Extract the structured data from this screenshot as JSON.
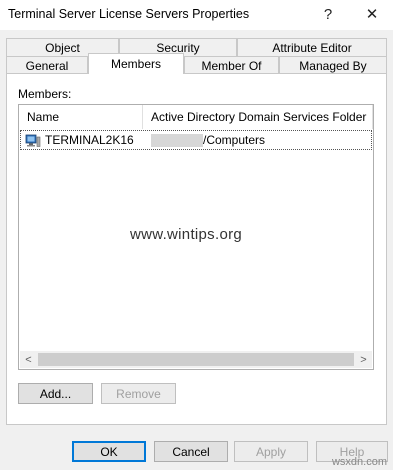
{
  "window": {
    "title": "Terminal Server License Servers Properties",
    "help_glyph": "?",
    "close_glyph": "✕"
  },
  "tabs": {
    "row1": [
      "Object",
      "Security",
      "Attribute Editor"
    ],
    "row2": [
      "General",
      "Members",
      "Member Of",
      "Managed By"
    ],
    "selected": "Members"
  },
  "members": {
    "label": "Members:",
    "columns": [
      "Name",
      "Active Directory Domain Services Folder"
    ],
    "rows": [
      {
        "name": "TERMINAL2K16",
        "folder": "/Computers",
        "icon": "computer-icon"
      }
    ]
  },
  "buttons": {
    "add": "Add...",
    "remove": "Remove",
    "ok": "OK",
    "cancel": "Cancel",
    "apply": "Apply",
    "help": "Help"
  },
  "scrollbar": {
    "left_arrow": "<",
    "right_arrow": ">"
  },
  "watermark": "www.wintips.org",
  "corner_mark": "wsxdn.com",
  "colors": {
    "accent": "#0078d7",
    "dialog_bg": "#f0f0f0"
  }
}
